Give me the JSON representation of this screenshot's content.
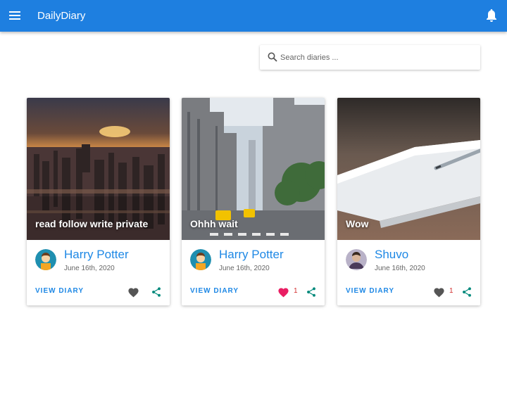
{
  "app": {
    "title": "DailyDiary"
  },
  "search": {
    "placeholder": "Search diaries ..."
  },
  "colors": {
    "appbar": "#1e7fe0",
    "link": "#1e88e5",
    "heart_active": "#e91e63",
    "heart_inactive": "#555555",
    "share": "#00897b"
  },
  "cards": [
    {
      "title": "read follow write private",
      "author": "Harry Potter",
      "date": "June 16th, 2020",
      "view_label": "VIEW DIARY",
      "likes": "",
      "liked": false,
      "avatar_icon": "cartoon-man-avatar",
      "share_icon": "share-icon"
    },
    {
      "title": "Ohhh wait",
      "author": "Harry Potter",
      "date": "June 16th, 2020",
      "view_label": "VIEW DIARY",
      "likes": "1",
      "liked": true,
      "avatar_icon": "cartoon-man-avatar",
      "share_icon": "share-icon"
    },
    {
      "title": "Wow",
      "author": "Shuvo",
      "date": "June 16th, 2020",
      "view_label": "VIEW DIARY",
      "likes": "1",
      "liked": false,
      "avatar_icon": "photo-avatar",
      "share_icon": "share-icon"
    }
  ]
}
